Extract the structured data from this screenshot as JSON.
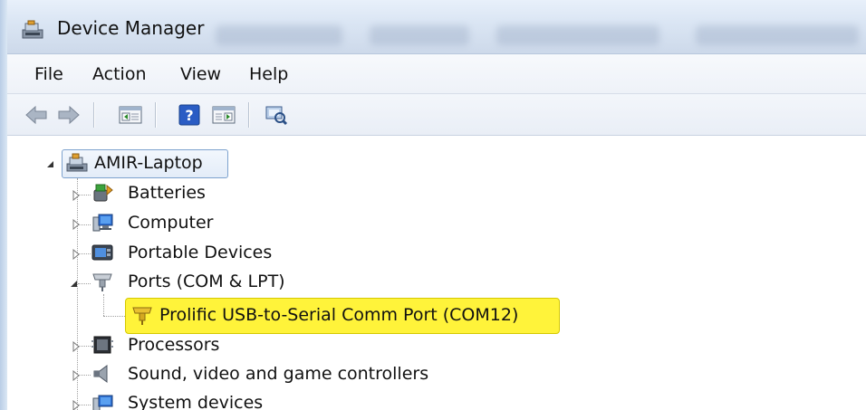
{
  "window": {
    "title": "Device Manager"
  },
  "menu": [
    "File",
    "Action",
    "View",
    "Help"
  ],
  "toolbar": {
    "buttons": [
      "back-arrow-icon",
      "forward-arrow-icon",
      "show-hide-console-tree-icon",
      "help-icon",
      "show-action-pane-icon",
      "scan-hardware-changes-icon"
    ]
  },
  "tree": {
    "root": "AMIR-Laptop",
    "items": [
      {
        "label": "Batteries",
        "icon": "battery-icon"
      },
      {
        "label": "Computer",
        "icon": "computer-icon"
      },
      {
        "label": "Portable Devices",
        "icon": "portable-device-icon"
      },
      {
        "label": "Ports (COM & LPT)",
        "icon": "port-connector-icon"
      },
      {
        "label": "Prolific USB-to-Serial Comm Port (COM12)",
        "icon": "serial-port-icon"
      },
      {
        "label": "Processors",
        "icon": "processor-chip-icon"
      },
      {
        "label": "Sound, video and game controllers",
        "icon": "speaker-icon"
      },
      {
        "label": "System devices",
        "icon": "system-devices-icon"
      }
    ]
  },
  "colors": {
    "highlight": "#fff33a",
    "titlebar": "#dbe6f4"
  }
}
